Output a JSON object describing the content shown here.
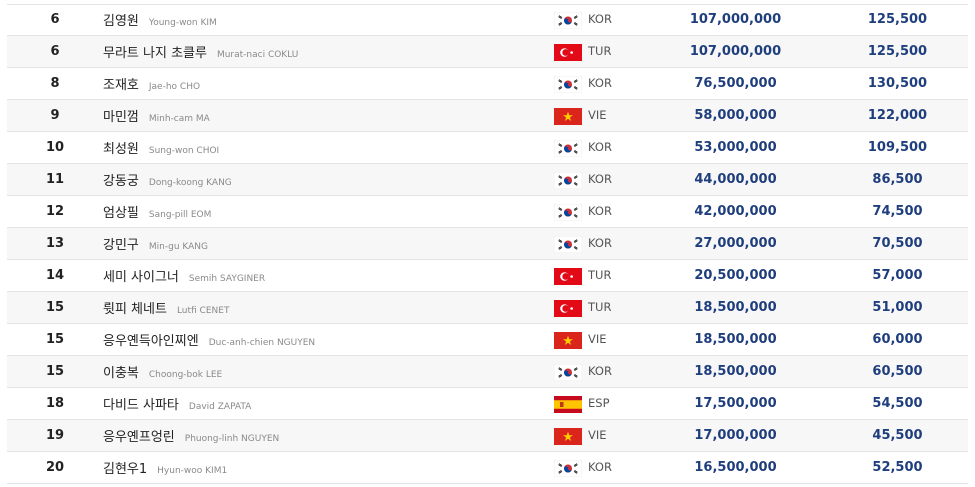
{
  "colors": {
    "accent": "#1f3e7e",
    "row_alt": "#f7f7f7",
    "border": "#e3e3e3"
  },
  "rows": [
    {
      "rank": "6",
      "kname": "김영원",
      "ename": "Young-won KIM",
      "flag": "flag-korea-icon",
      "country": "KOR",
      "prize": "107,000,000",
      "points": "125,500"
    },
    {
      "rank": "6",
      "kname": "무라트 나지 초클루",
      "ename": "Murat-naci COKLU",
      "flag": "flag-turkey-icon",
      "country": "TUR",
      "prize": "107,000,000",
      "points": "125,500"
    },
    {
      "rank": "8",
      "kname": "조재호",
      "ename": "Jae-ho CHO",
      "flag": "flag-korea-icon",
      "country": "KOR",
      "prize": "76,500,000",
      "points": "130,500"
    },
    {
      "rank": "9",
      "kname": "마민껌",
      "ename": "Minh-cam MA",
      "flag": "flag-vietnam-icon",
      "country": "VIE",
      "prize": "58,000,000",
      "points": "122,000"
    },
    {
      "rank": "10",
      "kname": "최성원",
      "ename": "Sung-won CHOI",
      "flag": "flag-korea-icon",
      "country": "KOR",
      "prize": "53,000,000",
      "points": "109,500"
    },
    {
      "rank": "11",
      "kname": "강동궁",
      "ename": "Dong-koong KANG",
      "flag": "flag-korea-icon",
      "country": "KOR",
      "prize": "44,000,000",
      "points": "86,500"
    },
    {
      "rank": "12",
      "kname": "엄상필",
      "ename": "Sang-pill EOM",
      "flag": "flag-korea-icon",
      "country": "KOR",
      "prize": "42,000,000",
      "points": "74,500"
    },
    {
      "rank": "13",
      "kname": "강민구",
      "ename": "Min-gu KANG",
      "flag": "flag-korea-icon",
      "country": "KOR",
      "prize": "27,000,000",
      "points": "70,500"
    },
    {
      "rank": "14",
      "kname": "세미 사이그너",
      "ename": "Semih SAYGINER",
      "flag": "flag-turkey-icon",
      "country": "TUR",
      "prize": "20,500,000",
      "points": "57,000"
    },
    {
      "rank": "15",
      "kname": "륏피 체네트",
      "ename": "Lutfi CENET",
      "flag": "flag-turkey-icon",
      "country": "TUR",
      "prize": "18,500,000",
      "points": "51,000"
    },
    {
      "rank": "15",
      "kname": "응우옌득아인찌엔",
      "ename": "Duc-anh-chien NGUYEN",
      "flag": "flag-vietnam-icon",
      "country": "VIE",
      "prize": "18,500,000",
      "points": "60,000"
    },
    {
      "rank": "15",
      "kname": "이충복",
      "ename": "Choong-bok LEE",
      "flag": "flag-korea-icon",
      "country": "KOR",
      "prize": "18,500,000",
      "points": "60,500"
    },
    {
      "rank": "18",
      "kname": "다비드 사파타",
      "ename": "David ZAPATA",
      "flag": "flag-spain-icon",
      "country": "ESP",
      "prize": "17,500,000",
      "points": "54,500"
    },
    {
      "rank": "19",
      "kname": "응우옌프엉린",
      "ename": "Phuong-linh NGUYEN",
      "flag": "flag-vietnam-icon",
      "country": "VIE",
      "prize": "17,000,000",
      "points": "45,500"
    },
    {
      "rank": "20",
      "kname": "김현우1",
      "ename": "Hyun-woo KIM1",
      "flag": "flag-korea-icon",
      "country": "KOR",
      "prize": "16,500,000",
      "points": "52,500"
    }
  ]
}
